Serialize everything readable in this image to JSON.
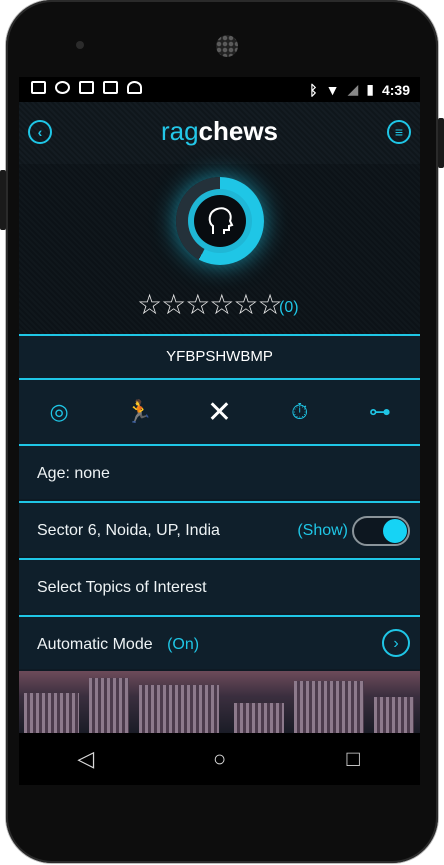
{
  "status_bar": {
    "left_icons": [
      "image-icon",
      "chat-icon",
      "gmail-icon",
      "card-icon",
      "android-icon"
    ],
    "right_icons": [
      "bluetooth-icon",
      "wifi-icon",
      "no-signal-icon",
      "battery-charging-icon"
    ],
    "time": "4:39"
  },
  "app_bar": {
    "logo_part1": "rag",
    "logo_part2": "chews",
    "back_icon": "‹",
    "menu_icon": "≡"
  },
  "profile": {
    "avatar_icon": "head-profile-icon",
    "stars": "☆☆☆☆☆☆",
    "rating_count": "(0)"
  },
  "username": "YFBPSHWBMP",
  "icon_bar": [
    {
      "name": "target-icon",
      "glyph": "◎",
      "active": false
    },
    {
      "name": "running-icon",
      "glyph": "🏃",
      "active": false
    },
    {
      "name": "fork-knife-icon",
      "glyph": "✕",
      "active": true
    },
    {
      "name": "stopwatch-icon",
      "glyph": "⏱",
      "active": false
    },
    {
      "name": "dumbbell-icon",
      "glyph": "⊶",
      "active": false
    }
  ],
  "age_label": "Age: none",
  "location": {
    "text": "Sector 6, Noida, UP, India",
    "show_label": "(Show)",
    "toggle_on": true
  },
  "topics_label": "Select Topics of Interest",
  "auto_mode": {
    "label": "Automatic Mode",
    "state": "(On)",
    "chevron": "›"
  },
  "nav": {
    "back": "◁",
    "home": "○",
    "recents": "□"
  },
  "colors": {
    "accent": "#1fc6e6",
    "background": "#0f1f2b",
    "text": "#eef3f5"
  }
}
